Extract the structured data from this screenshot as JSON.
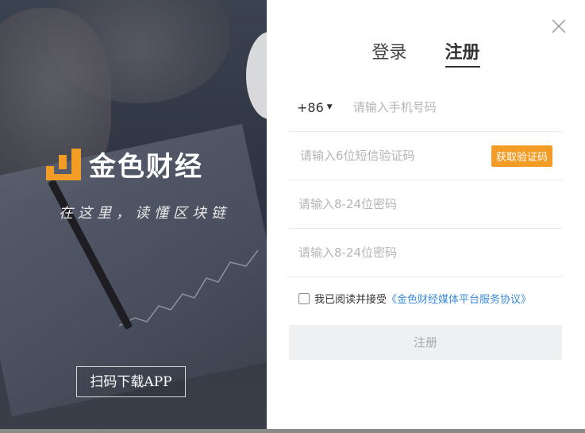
{
  "left": {
    "brand": "金色财经",
    "slogan": "在这里，读懂区块链",
    "app_button": "扫码下载APP"
  },
  "dialog": {
    "tabs": [
      {
        "label": "登录",
        "active": false
      },
      {
        "label": "注册",
        "active": true
      }
    ],
    "phone": {
      "country_code": "+86",
      "placeholder": "请输入手机号码"
    },
    "sms": {
      "placeholder": "请输入6位短信验证码",
      "button": "获取验证码"
    },
    "password": {
      "placeholder": "请输入8-24位密码"
    },
    "password_confirm": {
      "placeholder": "请输入8-24位密码"
    },
    "agreement": {
      "text": "我已阅读并接受",
      "link": "《金色财经媒体平台服务协议》",
      "checked": false
    },
    "submit": "注册"
  },
  "colors": {
    "accent": "#f29c25",
    "link": "#3b8bd9"
  },
  "icons": [
    "close-icon",
    "caret-down-icon",
    "logo-icon",
    "checkbox-icon"
  ]
}
